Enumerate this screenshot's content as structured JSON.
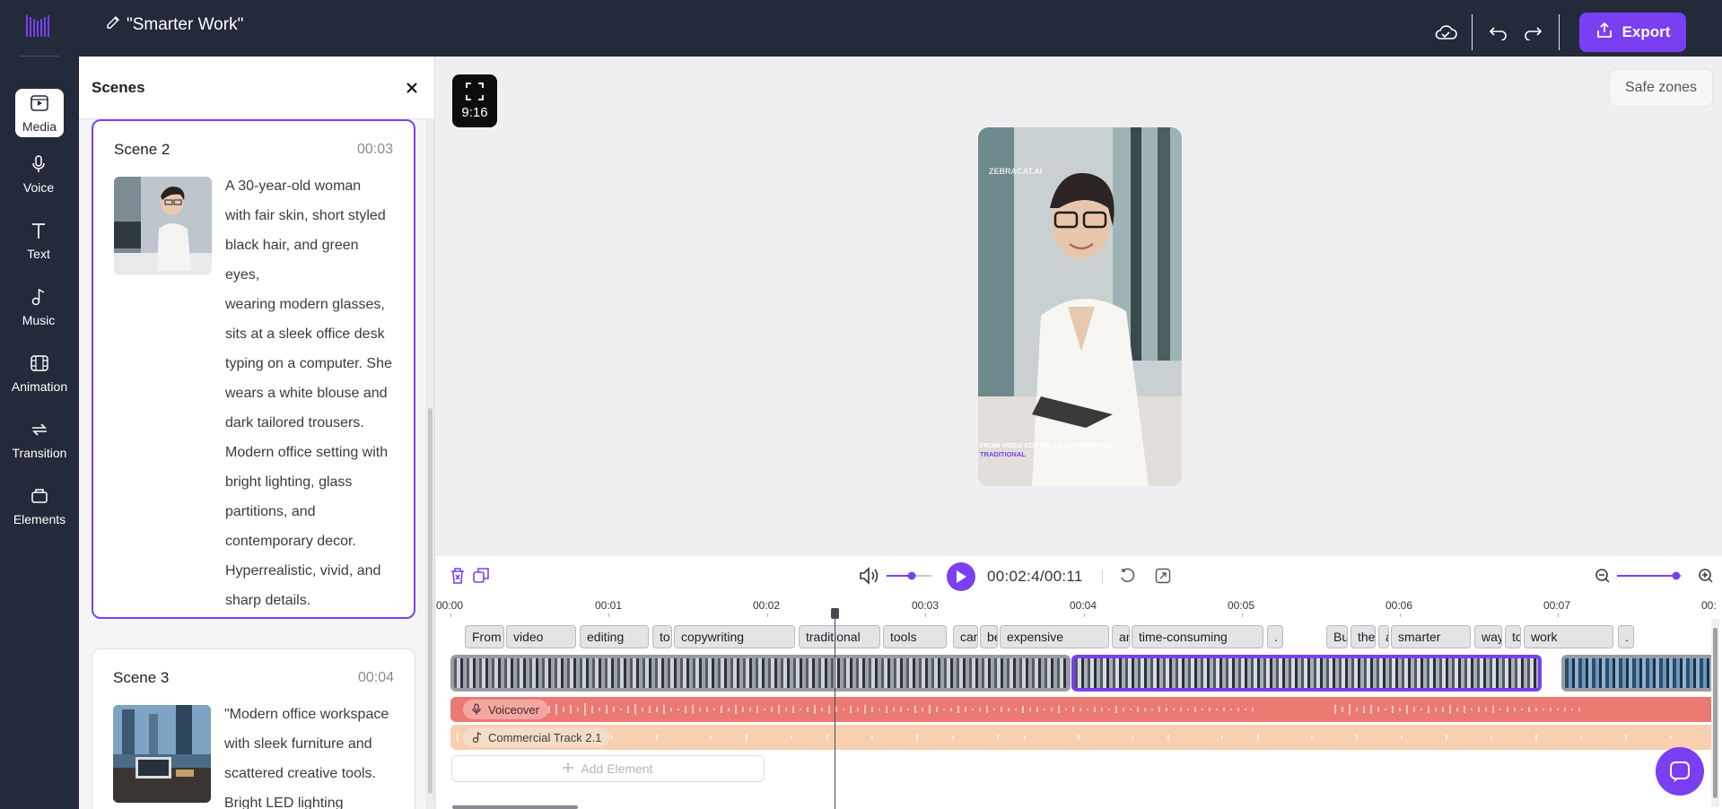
{
  "app": {
    "project_title": "\"Smarter Work\"",
    "export_label": "Export",
    "brand_color": "#7b3ff2",
    "nav_bg": "#232a39"
  },
  "nav": {
    "items": [
      {
        "label": "Media",
        "icon": "media-icon",
        "active": true
      },
      {
        "label": "Voice",
        "icon": "microphone-icon"
      },
      {
        "label": "Text",
        "icon": "text-icon"
      },
      {
        "label": "Music",
        "icon": "music-note-icon"
      },
      {
        "label": "Animation",
        "icon": "film-icon"
      },
      {
        "label": "Transition",
        "icon": "transition-arrows-icon"
      },
      {
        "label": "Elements",
        "icon": "shapes-icon"
      }
    ]
  },
  "scenes_panel": {
    "title": "Scenes",
    "scenes": [
      {
        "title": "Scene 2",
        "time": "00:03",
        "description_lines": [
          "A 30-year-old woman",
          "with fair skin, short styled",
          "black hair, and green eyes,",
          "wearing modern glasses,",
          "sits at a sleek office desk",
          "typing on a computer. She",
          "wears a white blouse and",
          "dark tailored trousers.",
          "Modern office setting with",
          "bright lighting, glass",
          "partitions, and",
          "contemporary decor.",
          "Hyperrealistic, vivid, and",
          "sharp details."
        ]
      },
      {
        "title": "Scene 3",
        "time": "00:04",
        "description_lines": [
          "\"Modern office workspace",
          "with sleek furniture and",
          "scattered creative tools.",
          "Bright LED lighting"
        ]
      }
    ]
  },
  "preview": {
    "aspect_ratio": "9:16",
    "safe_zones_label": "Safe zones",
    "video_watermark": "ZEBRACAT.AI",
    "caption_line1": "FROM VIDEO EDITING TO COPYWRITING,",
    "caption_line2": "TRADITIONAL"
  },
  "timeline": {
    "timecode": "00:02:4/00:11",
    "ruler_labels": [
      "00:00",
      "00:01",
      "00:02",
      "00:03",
      "00:04",
      "00:05",
      "00:06",
      "00:07",
      "00:"
    ],
    "words": [
      "From",
      "video",
      "editing",
      "to",
      "copywriting",
      "traditional",
      "tools",
      "can",
      "be",
      "expensive",
      "and",
      "time-consuming",
      ".",
      "But",
      "there",
      "a",
      "smarter",
      "way",
      "to",
      "work",
      "."
    ],
    "voiceover_label": "Voiceover",
    "music_label": "Commercial Track 2.1",
    "add_element_label": "Add Element"
  }
}
